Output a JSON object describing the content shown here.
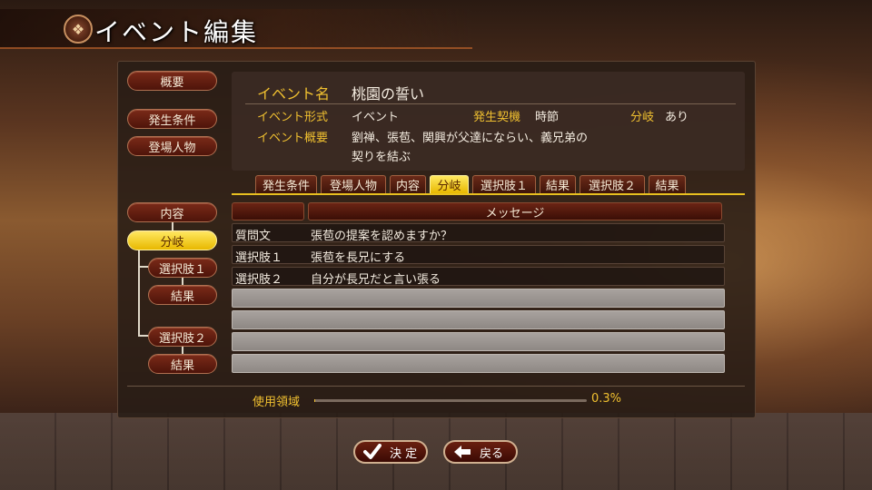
{
  "window": {
    "title": "イベント編集",
    "emblem_icon": "crest-icon"
  },
  "sidebar_top": {
    "overview": "概要",
    "condition": "発生条件",
    "characters": "登場人物"
  },
  "sidebar_tree": {
    "content": "内容",
    "branch": "分岐",
    "choice1": "選択肢１",
    "result1": "結果",
    "choice2": "選択肢２",
    "result2": "結果"
  },
  "info": {
    "name_label": "イベント名",
    "name_value": "桃園の誓い",
    "format_label": "イベント形式",
    "format_value": "イベント",
    "trigger_label": "発生契機",
    "trigger_value": "時節",
    "branch_label": "分岐",
    "branch_value": "あり",
    "summary_label": "イベント概要",
    "summary_line1": "劉禅、張苞、関興が父達にならい、義兄弟の",
    "summary_line2": "契りを結ぶ"
  },
  "tabs": [
    "発生条件",
    "登場人物",
    "内容",
    "分岐",
    "選択肢１",
    "結果",
    "選択肢２",
    "結果"
  ],
  "active_tab_index": 3,
  "table": {
    "header_message": "メッセージ",
    "rows": [
      {
        "label": "質問文",
        "message": "張苞の提案を認めますか？"
      },
      {
        "label": "選択肢１",
        "message": "張苞を長兄にする"
      },
      {
        "label": "選択肢２",
        "message": "自分が長兄だと言い張る"
      }
    ]
  },
  "usage": {
    "label": "使用領域",
    "value": "0.3%",
    "fraction": 0.003
  },
  "buttons": {
    "confirm_label": "決 定",
    "confirm_icon": "checkmark-icon",
    "back_label": "戻る",
    "back_icon": "arrow-left-icon"
  },
  "colors": {
    "accent_gold": "#f0c030",
    "active_tab": "#ffe860",
    "pill_red": "#5a1a0c"
  }
}
